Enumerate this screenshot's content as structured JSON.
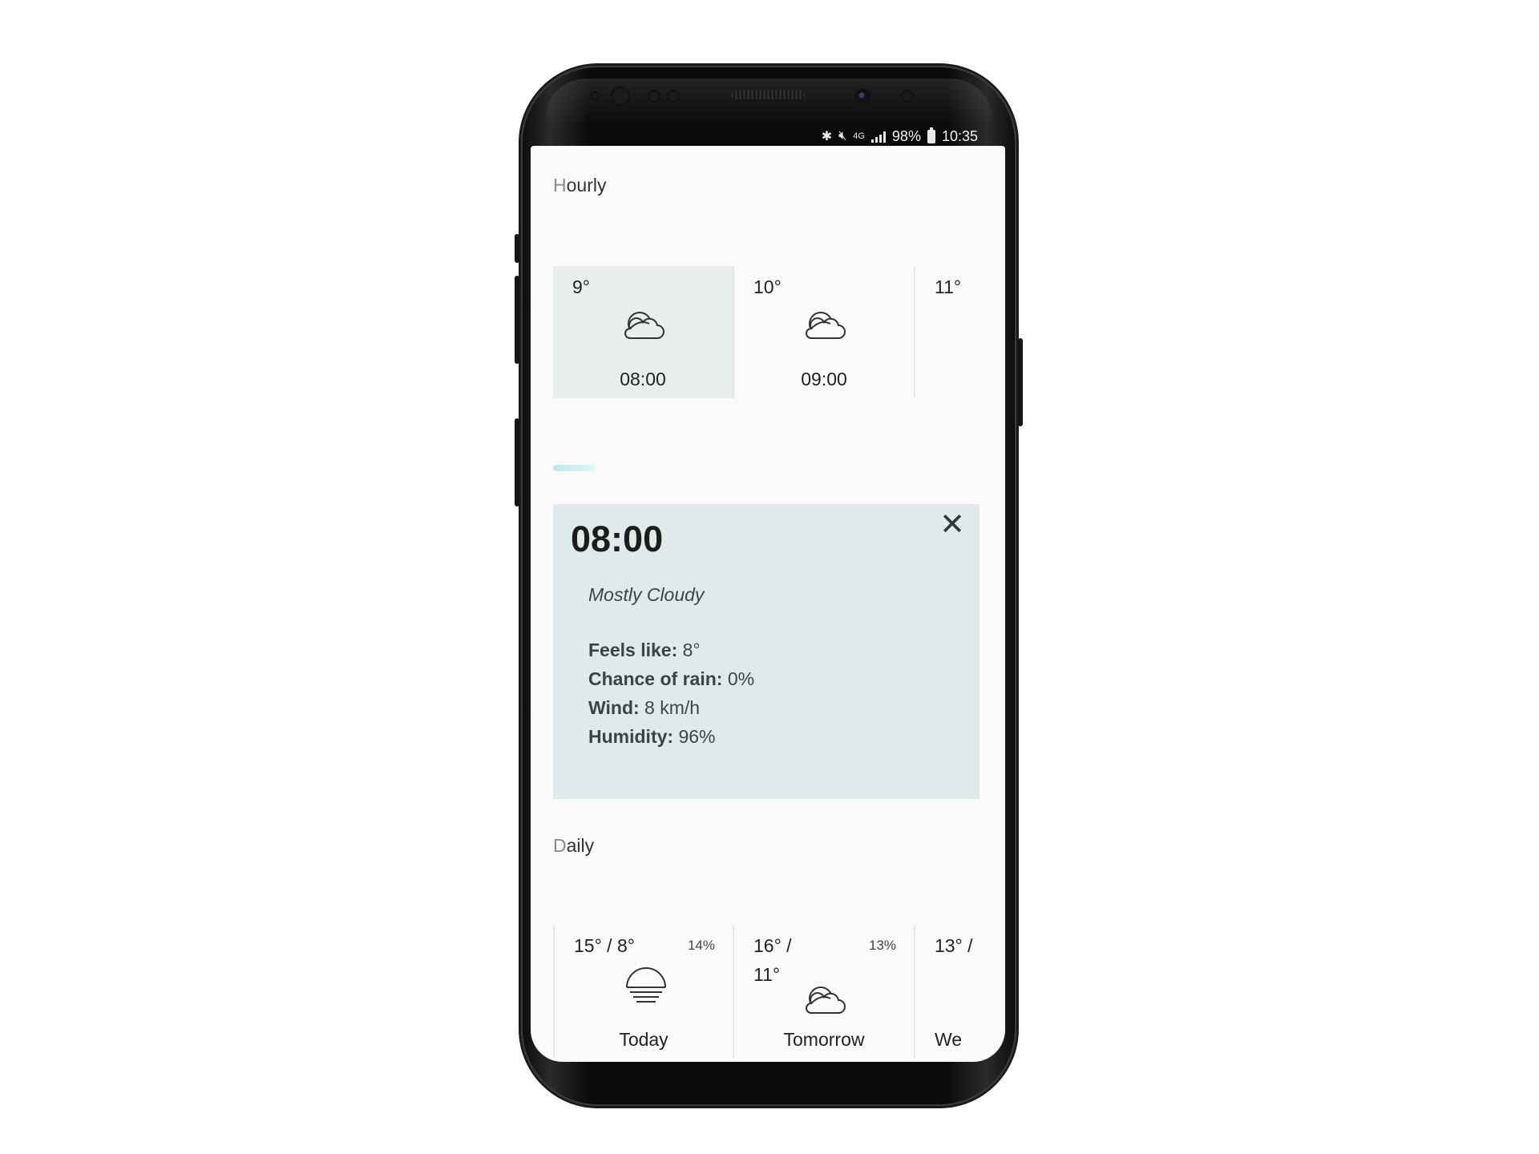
{
  "status_bar": {
    "bluetooth_icon": "bluetooth-icon",
    "mute_icon": "mute-icon",
    "network": "4G",
    "battery": "98%",
    "time": "10:35"
  },
  "hourly": {
    "title_first": "H",
    "title_rest": "ourly",
    "items": [
      {
        "temp": "9°",
        "icon": "cloud-icon",
        "time": "08:00",
        "selected": true
      },
      {
        "temp": "10°",
        "icon": "cloud-icon",
        "time": "09:00",
        "selected": false
      },
      {
        "temp": "11°",
        "icon": "",
        "time": "",
        "selected": false
      }
    ]
  },
  "detail": {
    "time": "08:00",
    "close_icon": "close-icon",
    "condition": "Mostly Cloudy",
    "feels_like_label": "Feels like:",
    "feels_like_value": "8°",
    "rain_label": "Chance of rain:",
    "rain_value": "0%",
    "wind_label": "Wind:",
    "wind_value": "8 km/h",
    "humidity_label": "Humidity:",
    "humidity_value": "96%"
  },
  "daily": {
    "title_first": "D",
    "title_rest": "aily",
    "items": [
      {
        "temp": "15° / 8°",
        "rain": "14%",
        "icon": "sun-haze-icon",
        "day": "Today"
      },
      {
        "temp": "16° /\n11°",
        "rain": "13%",
        "icon": "cloud-icon",
        "day": "Tomorrow"
      },
      {
        "temp": "13° /",
        "rain": "",
        "icon": "",
        "day": "We"
      }
    ]
  },
  "colors": {
    "selected_card": "#e9eeed",
    "detail_bg": "#e1eaea",
    "indicator": "#bfe8ea"
  }
}
